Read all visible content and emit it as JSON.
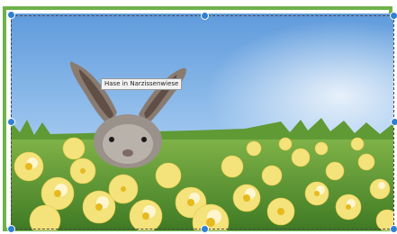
{
  "image": {
    "tooltip": "Hase in Narzissenwiese",
    "subject_icon": "rabbit-in-daffodils-photo"
  },
  "colors": {
    "frame_border": "#6fb24a",
    "handle": "#2f7fd3",
    "sky": "#7fb3e6",
    "daffodil": "#f4e27a"
  }
}
